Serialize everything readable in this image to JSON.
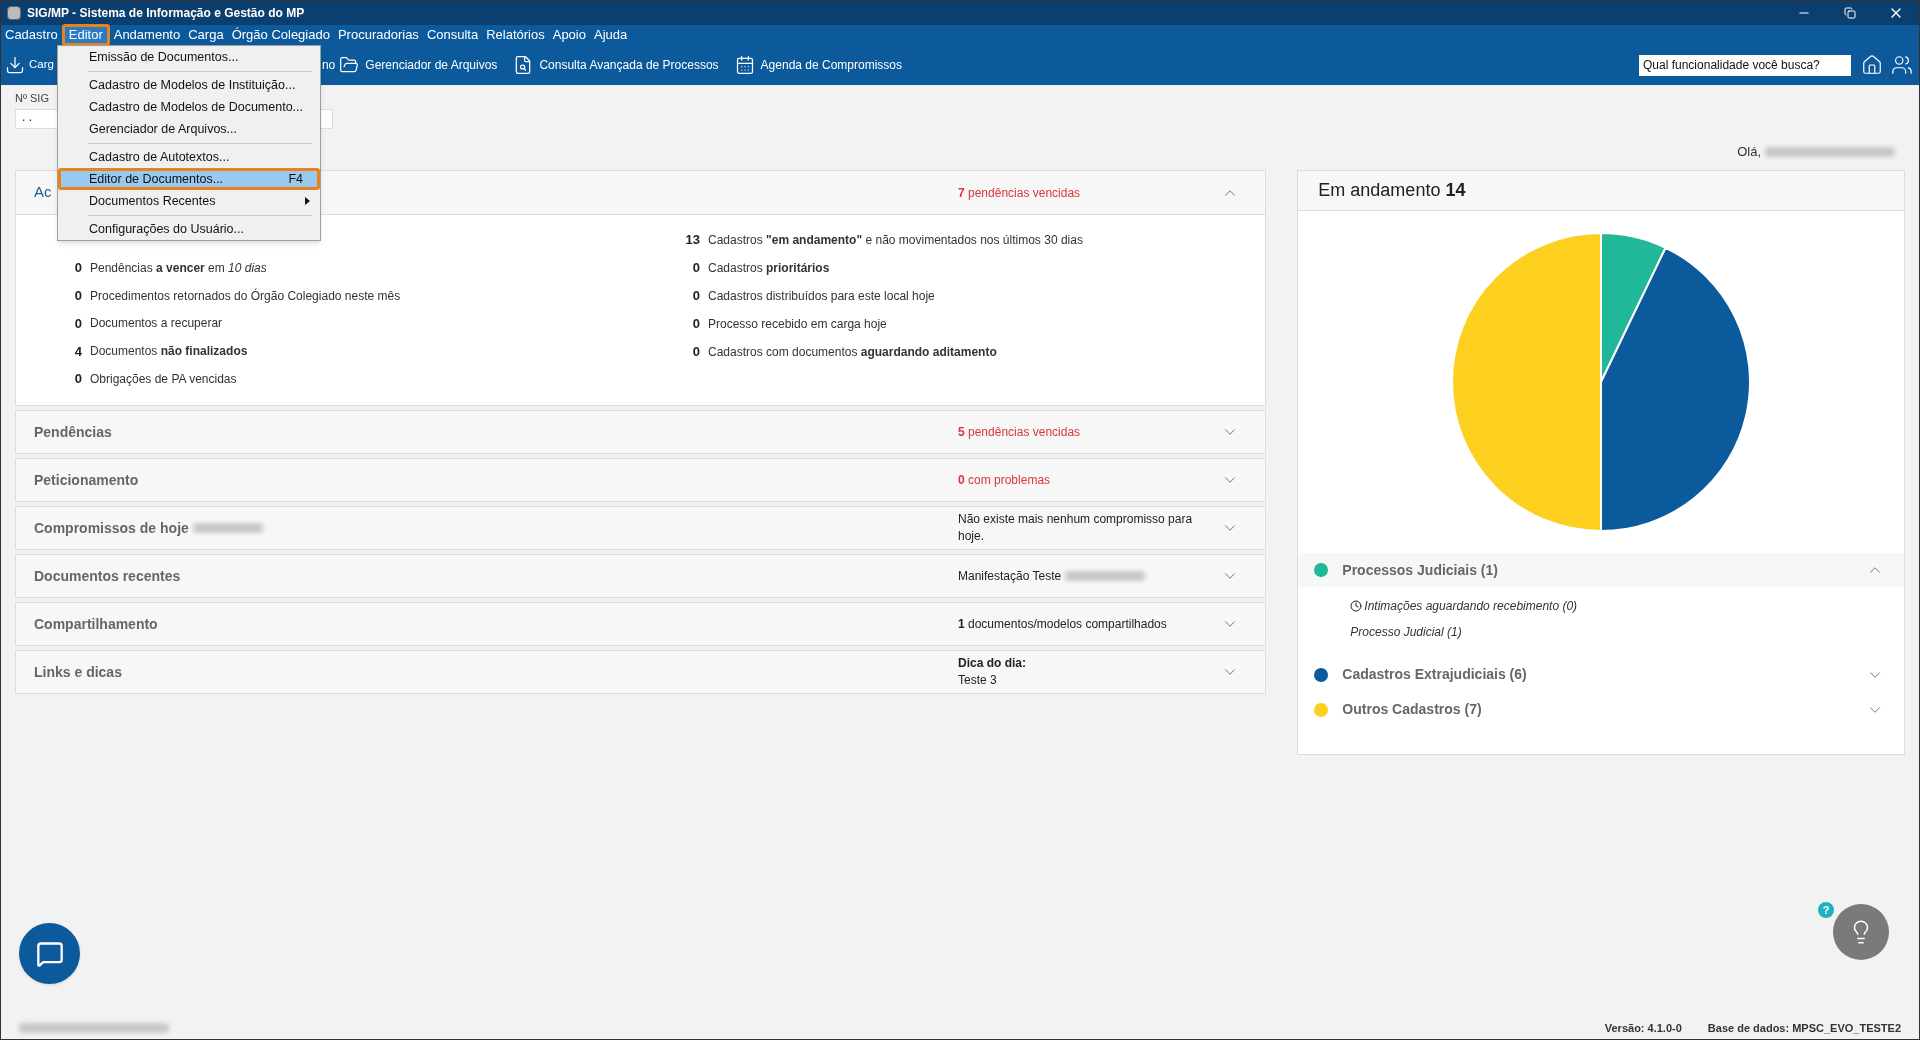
{
  "window": {
    "title": "SIG/MP - Sistema de Informação e Gestão do MP"
  },
  "menu_bar": [
    {
      "label": "Cadastro",
      "selected": false
    },
    {
      "label": "Editor",
      "selected": true
    },
    {
      "label": "Andamento",
      "selected": false
    },
    {
      "label": "Carga",
      "selected": false
    },
    {
      "label": "Órgão Colegiado",
      "selected": false
    },
    {
      "label": "Procuradorias",
      "selected": false
    },
    {
      "label": "Consulta",
      "selected": false
    },
    {
      "label": "Relatórios",
      "selected": false
    },
    {
      "label": "Apoio",
      "selected": false
    },
    {
      "label": "Ajuda",
      "selected": false
    }
  ],
  "editor_menu": [
    {
      "kind": "item",
      "label": "Emissão de Documentos...",
      "selected": false
    },
    {
      "kind": "separator"
    },
    {
      "kind": "item",
      "label": "Cadastro de Modelos de Instituição...",
      "selected": false
    },
    {
      "kind": "item",
      "label": "Cadastro de Modelos de Documento...",
      "selected": false
    },
    {
      "kind": "item",
      "label": "Gerenciador de Arquivos...",
      "selected": false
    },
    {
      "kind": "separator"
    },
    {
      "kind": "item",
      "label": "Cadastro de Autotextos...",
      "selected": false
    },
    {
      "kind": "item",
      "label": "Editor de Documentos...",
      "shortcut": "F4",
      "selected": true
    },
    {
      "kind": "submenu",
      "label": "Documentos Recentes",
      "selected": false
    },
    {
      "kind": "separator"
    },
    {
      "kind": "item",
      "label": "Configurações do Usuário...",
      "selected": false
    }
  ],
  "toolbar": [
    {
      "kind": "download",
      "label": "Carg"
    },
    {
      "kind": "text",
      "label": "no"
    },
    {
      "kind": "folder",
      "label": "Gerenciador de Arquivos"
    },
    {
      "kind": "search",
      "label": "Consulta Avançada de Processos"
    },
    {
      "kind": "calendar",
      "label": "Agenda de Compromissos"
    }
  ],
  "search": {
    "placeholder": "Qual funcionalidade você busca?"
  },
  "sig_field": {
    "label": "Nº SIG",
    "value": ". ."
  },
  "greeting": "Olá,",
  "summary_card": {
    "title": "Ac",
    "alert": "**7** pendências vencidas",
    "expanded": true,
    "left_items": [
      {
        "count": "0",
        "text": "Pendências **a vencer** em *10 dias*"
      },
      {
        "count": "0",
        "text": "Procedimentos retornados do Órgão Colegiado neste mês"
      },
      {
        "count": "0",
        "text": "Documentos a recuperar"
      },
      {
        "count": "4",
        "text": "Documentos **não finalizados**"
      },
      {
        "count": "0",
        "text": "Obrigações de PA vencidas"
      }
    ],
    "right_items": [
      {
        "count": "13",
        "text": "Cadastros **\"em andamento\"** e não movimentados nos últimos 30 dias"
      },
      {
        "count": "0",
        "text": "Cadastros **prioritários**"
      },
      {
        "count": "0",
        "text": "Cadastros distribuídos para este local hoje"
      },
      {
        "count": "0",
        "text": "Processo recebido em carga hoje"
      },
      {
        "count": "0",
        "text": "Cadastros com documentos **aguardando aditamento**"
      }
    ]
  },
  "sections": [
    {
      "title": "Pendências",
      "kind": "alert",
      "info": [
        "**5** pendências vencidas"
      ],
      "expanded": false
    },
    {
      "title": "Peticionamento",
      "kind": "alert",
      "info": [
        "**0** com problemas"
      ],
      "expanded": false
    },
    {
      "title": "Compromissos de hoje",
      "title_redacted": true,
      "kind": "normal",
      "info": [
        "Não existe mais nenhum compromisso para hoje."
      ],
      "expanded": false
    },
    {
      "title": "Documentos recentes",
      "kind": "normal",
      "info": [
        "Manifestação Teste"
      ],
      "info_redacted": true,
      "expanded": false
    },
    {
      "title": "Compartilhamento",
      "kind": "normal",
      "info": [
        "**1** documentos/modelos compartilhados"
      ],
      "expanded": false
    },
    {
      "title": "Links e dicas",
      "kind": "normal",
      "info": [
        "**Dica do dia:**",
        "Teste 3"
      ],
      "expanded": false
    }
  ],
  "status_panel": {
    "title": "Em andamento **14**",
    "chart_data": {
      "type": "pie",
      "values": [
        7.14,
        42.86,
        50
      ]
    },
    "legend": [
      {
        "label": "Processos Judiciais (**1**)",
        "color": "#20b899",
        "expanded": true,
        "children": [
          {
            "kind": "clock",
            "label": "Intimações aguardando recebimento (0)"
          },
          {
            "kind": "plain",
            "label": "Processo Judicial (1)"
          }
        ]
      },
      {
        "label": "Cadastros Extrajudiciais (**6**)",
        "color": "#0b5a9c",
        "expanded": false
      },
      {
        "label": "Outros Cadastros (**7**)",
        "color": "#fdd020",
        "expanded": false
      }
    ]
  },
  "help": "?",
  "status_bar": {
    "version": "Versão: 4.1.0-0",
    "database": "Base de dados: MPSC_EVO_TESTE2"
  }
}
